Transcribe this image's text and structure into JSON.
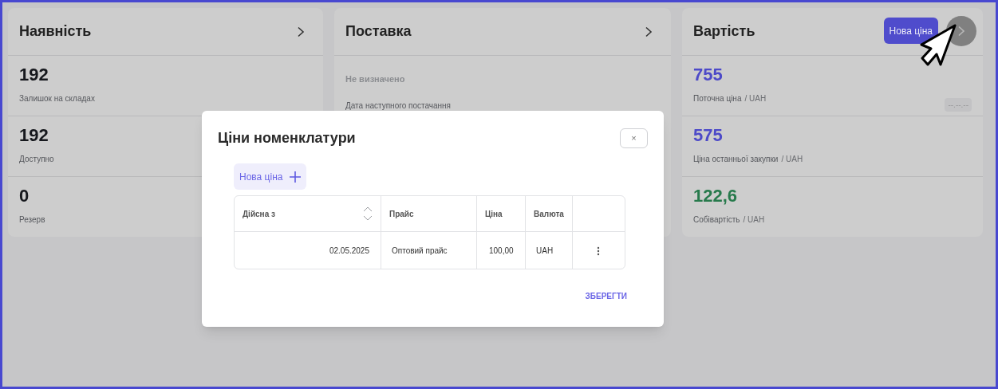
{
  "cards": [
    {
      "title": "Наявність",
      "chevron_hovered": false,
      "rows": [
        {
          "value": "192",
          "kind": "default",
          "label": "Залишок на складах"
        },
        {
          "value": "192",
          "kind": "default",
          "label": "Доступно"
        },
        {
          "value": "0",
          "kind": "default",
          "label": "Резерв"
        }
      ]
    },
    {
      "title": "Поставка",
      "chevron_hovered": false,
      "rows": [
        {
          "value": "Не визначено",
          "kind": "muted",
          "label": "Дата наступного постачання"
        }
      ]
    },
    {
      "title": "Вартість",
      "action_button": "Нова ціна",
      "chevron_hovered": true,
      "rows": [
        {
          "value": "755",
          "kind": "accent",
          "label": "Поточна ціна",
          "unit": "/ UAH",
          "badge": "--.--.--"
        },
        {
          "value": "575",
          "kind": "accent",
          "label": "Ціна останньої закупки",
          "unit": "/ UAH"
        },
        {
          "value": "122,6",
          "kind": "positive",
          "label": "Собівартість",
          "unit": "/ UAH"
        }
      ]
    }
  ],
  "dialog": {
    "title": "Ціни номенклатури",
    "close": "×",
    "add_button": "Нова ціна",
    "columns": [
      {
        "label": "Дійсна з",
        "sortable": true
      },
      {
        "label": "Прайс",
        "sortable": false
      },
      {
        "label": "Ціна",
        "sortable": false
      },
      {
        "label": "Валюта",
        "sortable": false
      }
    ],
    "rows": [
      {
        "cells": [
          "02.05.2025",
          "Оптовий прайс",
          "100,00",
          "UAH"
        ]
      }
    ],
    "save_button": "ЗБЕРЕГТИ"
  }
}
